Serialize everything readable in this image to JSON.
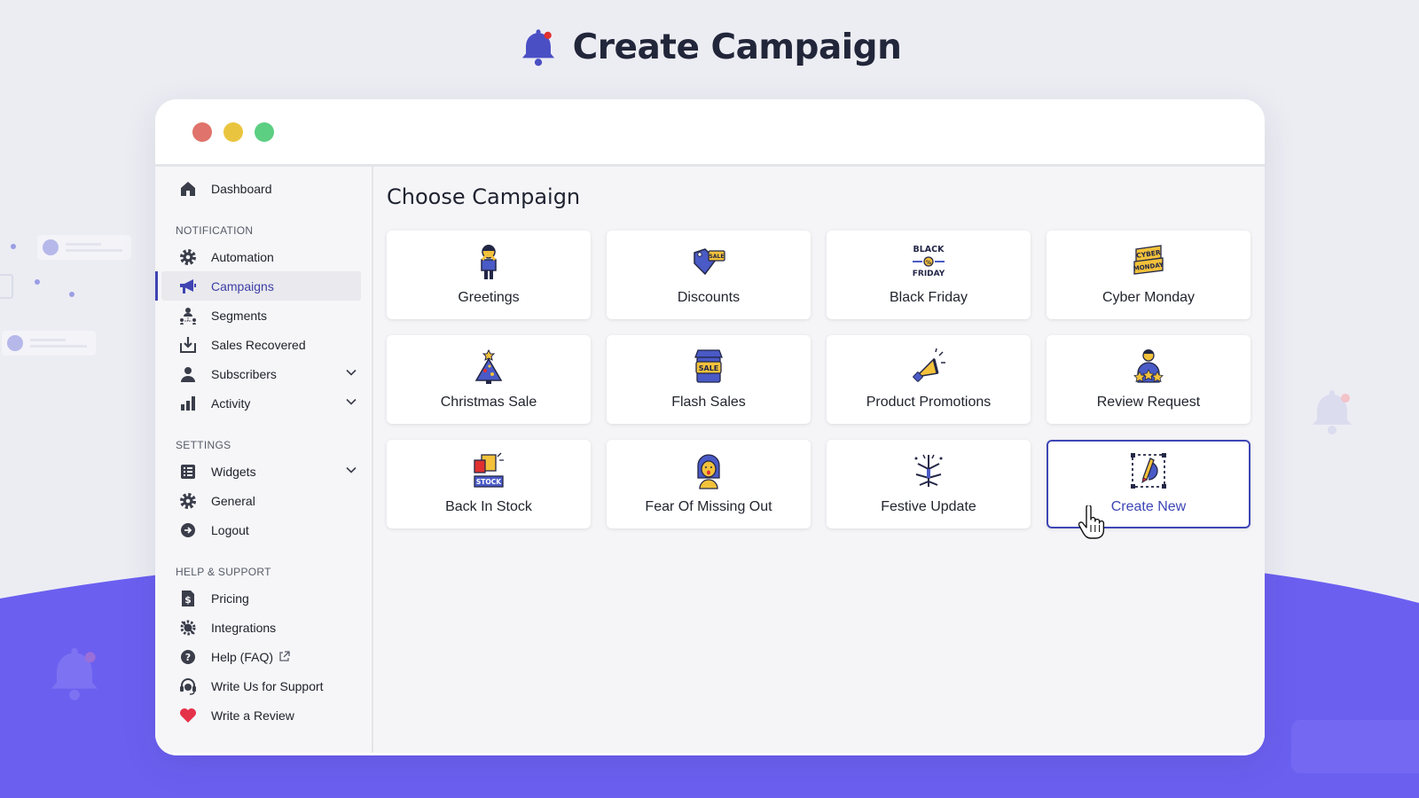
{
  "hero": {
    "title": "Create Campaign",
    "icon": "bell-icon"
  },
  "colors": {
    "accent": "#3d46b5",
    "wave": "#6b5ff0",
    "dot_red": "#e0736b",
    "dot_yellow": "#e9c53f",
    "dot_green": "#5ccf83"
  },
  "sidebar": {
    "dashboard": "Dashboard",
    "sections": {
      "notification": "NOTIFICATION",
      "settings": "SETTINGS",
      "help": "HELP & SUPPORT"
    },
    "notification_items": [
      {
        "label": "Automation",
        "icon": "gear-icon"
      },
      {
        "label": "Campaigns",
        "icon": "megaphone-icon",
        "active": true
      },
      {
        "label": "Segments",
        "icon": "segments-icon"
      },
      {
        "label": "Sales Recovered",
        "icon": "download-box-icon"
      },
      {
        "label": "Subscribers",
        "icon": "user-icon",
        "expandable": true
      },
      {
        "label": "Activity",
        "icon": "bar-chart-icon",
        "expandable": true
      }
    ],
    "settings_items": [
      {
        "label": "Widgets",
        "icon": "list-icon",
        "expandable": true
      },
      {
        "label": "General",
        "icon": "gear-icon"
      },
      {
        "label": "Logout",
        "icon": "logout-icon"
      }
    ],
    "help_items": [
      {
        "label": "Pricing",
        "icon": "dollar-doc-icon"
      },
      {
        "label": "Integrations",
        "icon": "integrations-icon"
      },
      {
        "label": "Help (FAQ)",
        "icon": "question-icon",
        "external": true
      },
      {
        "label": "Write Us for Support",
        "icon": "headset-icon"
      },
      {
        "label": "Write a Review",
        "icon": "heart-icon"
      }
    ]
  },
  "main": {
    "title": "Choose Campaign",
    "cards": [
      {
        "label": "Greetings",
        "icon": "greeting-person-icon"
      },
      {
        "label": "Discounts",
        "icon": "sale-tag-icon"
      },
      {
        "label": "Black Friday",
        "icon": "black-friday-icon"
      },
      {
        "label": "Cyber Monday",
        "icon": "cyber-monday-icon"
      },
      {
        "label": "Christmas Sale",
        "icon": "christmas-tree-icon"
      },
      {
        "label": "Flash Sales",
        "icon": "sale-shop-icon"
      },
      {
        "label": "Product Promotions",
        "icon": "megaphone-promo-icon"
      },
      {
        "label": "Review Request",
        "icon": "person-stars-icon"
      },
      {
        "label": "Back In Stock",
        "icon": "stock-box-icon"
      },
      {
        "label": "Fear Of Missing Out",
        "icon": "surprised-person-icon"
      },
      {
        "label": "Festive Update",
        "icon": "fireworks-icon"
      },
      {
        "label": "Create New",
        "icon": "create-new-icon",
        "selected": true
      }
    ]
  },
  "icon_text": {
    "black": "BLACK",
    "friday": "FRIDAY",
    "cyber": "CYBER",
    "monday": "MONDAY",
    "sale": "SALE",
    "stock": "STOCK"
  }
}
